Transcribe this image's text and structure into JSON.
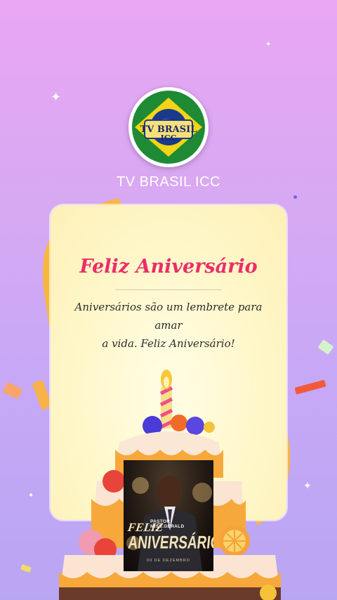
{
  "channel": {
    "name": "TV BRASIL ICC",
    "logo_text_line1": "TV BRASIL",
    "logo_text_line2": "ICC"
  },
  "card": {
    "title": "Feliz Aniversário",
    "message_line1": "Aniversários são um lembrete para amar",
    "message_line2": "a vida. Feliz Aniversário!"
  },
  "photo": {
    "pastor_line1": "PASTOR",
    "pastor_line2": "MISS.GERALD",
    "feliz": "FELIZ",
    "aniversario": "ANIVERSÁRIO",
    "date": "00 DE DEZEMBRO"
  },
  "colors": {
    "title": "#ec2d6a",
    "background_top": "#e9a6f3",
    "background_bottom": "#b9a6f3",
    "card": "#fff7c9"
  }
}
